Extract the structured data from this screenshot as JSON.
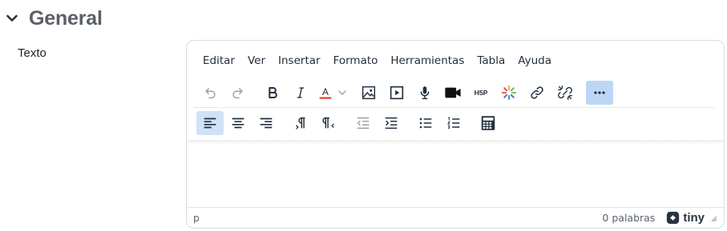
{
  "section": {
    "title": "General",
    "icon": "chevron-down-icon"
  },
  "field": {
    "label": "Texto"
  },
  "editor": {
    "menubar": [
      "Editar",
      "Ver",
      "Insertar",
      "Formato",
      "Herramientas",
      "Tabla",
      "Ayuda"
    ],
    "toolbar_row1": [
      "undo-icon",
      "redo-icon",
      "bold-icon",
      "italic-icon",
      "text-color-icon",
      "image-icon",
      "media-icon",
      "record-audio-icon",
      "record-video-icon",
      "h5p-icon",
      "multimedia-plugin-icon",
      "link-icon",
      "unlink-icon",
      "more-icon"
    ],
    "toolbar_row2": [
      "align-left-icon",
      "align-center-icon",
      "align-right-icon",
      "ltr-icon",
      "rtl-icon",
      "outdent-icon",
      "indent-icon",
      "bullet-list-icon",
      "numbered-list-icon",
      "calculator-icon"
    ],
    "text_color_letter": "A",
    "h5p_text": "H5P",
    "status": {
      "path": "p",
      "word_count": "0 palabras",
      "brand": "tiny"
    },
    "colors": {
      "more_button_bg": "#bcd6f6",
      "active_button_bg": "#cfe2f8",
      "text_color_underline": "#e03e2d",
      "icon": "#222f3e"
    }
  }
}
